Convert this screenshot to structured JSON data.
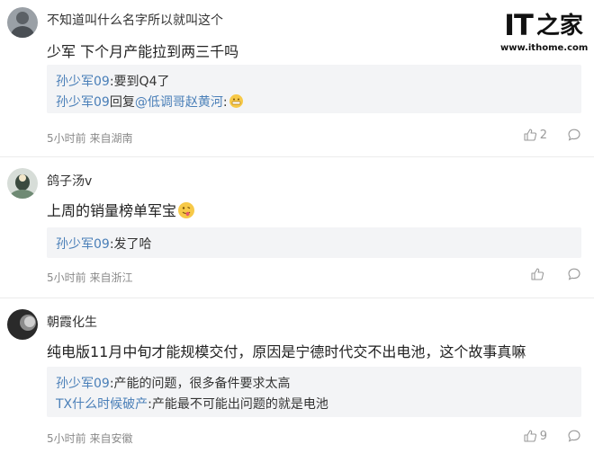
{
  "logo": {
    "mark": "IT",
    "mark_zh": "之家",
    "url": "www.ithome.com"
  },
  "comments": [
    {
      "username": "不知道叫什么名字所以就叫这个",
      "text": "少军 下个月产能拉到两三千吗",
      "replies": [
        {
          "author": "孙少军09",
          "sep": ":",
          "text": "要到Q4了"
        },
        {
          "author": "孙少军09",
          "mid": "回复",
          "mention": "@低调哥赵黄河",
          "sep": ":",
          "emoji": "grinning-emoji"
        }
      ],
      "meta": "5小时前 来自湖南",
      "likes": "2"
    },
    {
      "username": "鸽子汤v",
      "text": "上周的销量榜单军宝",
      "emoji": "tongue-emoji",
      "replies": [
        {
          "author": "孙少军09",
          "sep": ":",
          "text": "发了哈"
        }
      ],
      "meta": "5小时前 来自浙江",
      "likes": ""
    },
    {
      "username": "朝霞化生",
      "text": "纯电版11月中旬才能规模交付，原因是宁德时代交不出电池，这个故事真嘛",
      "replies": [
        {
          "author": "孙少军09",
          "sep": ":",
          "text": "产能的问题，很多备件要求太高"
        },
        {
          "author": "TX什么时候破产",
          "sep": ":",
          "text": "产能最不可能出问题的就是电池"
        }
      ],
      "meta": "5小时前 来自安徽",
      "likes": "9"
    }
  ],
  "icons": {
    "like": "thumbs-up-icon",
    "comment": "comment-bubble-icon"
  },
  "colors": {
    "link": "#4a7fb8",
    "reply_bg": "#f3f4f6",
    "meta": "#8a8a8a"
  }
}
